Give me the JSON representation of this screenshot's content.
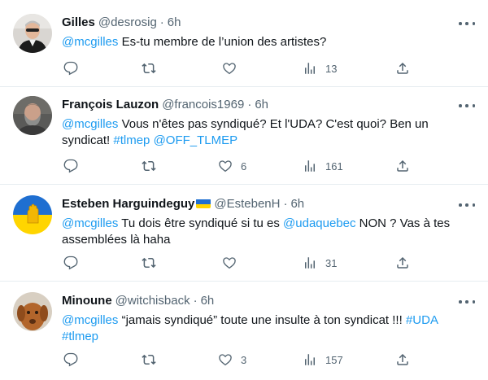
{
  "tweets": [
    {
      "name": "Gilles",
      "handle": "@desrosig",
      "time": "6h",
      "mention": "@mcgilles",
      "text": " Es-tu membre de l’union des artistes?",
      "reply_count": "",
      "retweet_count": "",
      "like_count": "",
      "views": "13"
    },
    {
      "name": "François Lauzon",
      "handle": "@francois1969",
      "time": "6h",
      "mention": "@mcgilles",
      "text": " Vous n'êtes pas syndiqué? Et l'UDA? C'est quoi? Ben un syndicat! ",
      "hashtag": "#tlmep",
      "mention2": "@OFF_TLMEP",
      "reply_count": "",
      "retweet_count": "",
      "like_count": "6",
      "views": "161"
    },
    {
      "name": "Esteben Harguindeguy",
      "handle": "@EstebenH",
      "time": "6h",
      "mention": "@mcgilles",
      "text_a": " Tu dois être syndiqué si tu es ",
      "mention2": "@udaquebec",
      "text_b": " NON ?  Vas à tes assemblées là haha",
      "reply_count": "",
      "retweet_count": "",
      "like_count": "",
      "views": "31"
    },
    {
      "name": "Minoune",
      "handle": "@witchisback",
      "time": "6h",
      "mention": "@mcgilles",
      "text": " “jamais syndiqué” toute une insulte à ton syndicat !!! ",
      "hashtag": "#UDA",
      "hashtag2": "#tlmep",
      "reply_count": "",
      "retweet_count": "",
      "like_count": "3",
      "views": "157"
    }
  ],
  "icons": {
    "reply": "reply-icon",
    "retweet": "retweet-icon",
    "like": "heart-icon",
    "views": "views-icon",
    "share": "share-icon",
    "more": "more-icon"
  },
  "colors": {
    "link": "#1d9bf0",
    "secondary": "#536471",
    "flag_blue": "#1f6fd1",
    "flag_yellow": "#ffd500"
  }
}
